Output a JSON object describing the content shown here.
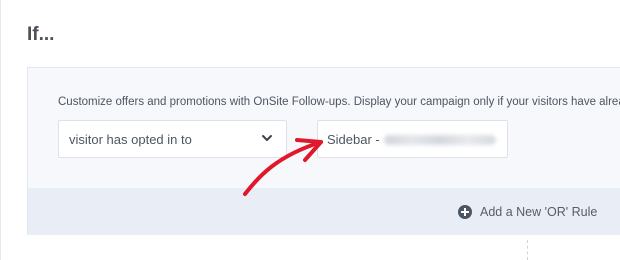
{
  "heading": "If...",
  "rule": {
    "description": "Customize offers and promotions with OnSite Follow-ups. Display your campaign only if your visitors have alread",
    "condition_select": {
      "value": "visitor has opted in to"
    },
    "campaign_field": {
      "prefix": "Sidebar - "
    },
    "add_or_rule_label": "Add a New 'OR' Rule"
  },
  "colors": {
    "arrow": "#e0182b",
    "footer_bar": "#e9eef6"
  },
  "icons": {
    "select": "chevron-down-icon",
    "add": "plus-circle-icon"
  }
}
